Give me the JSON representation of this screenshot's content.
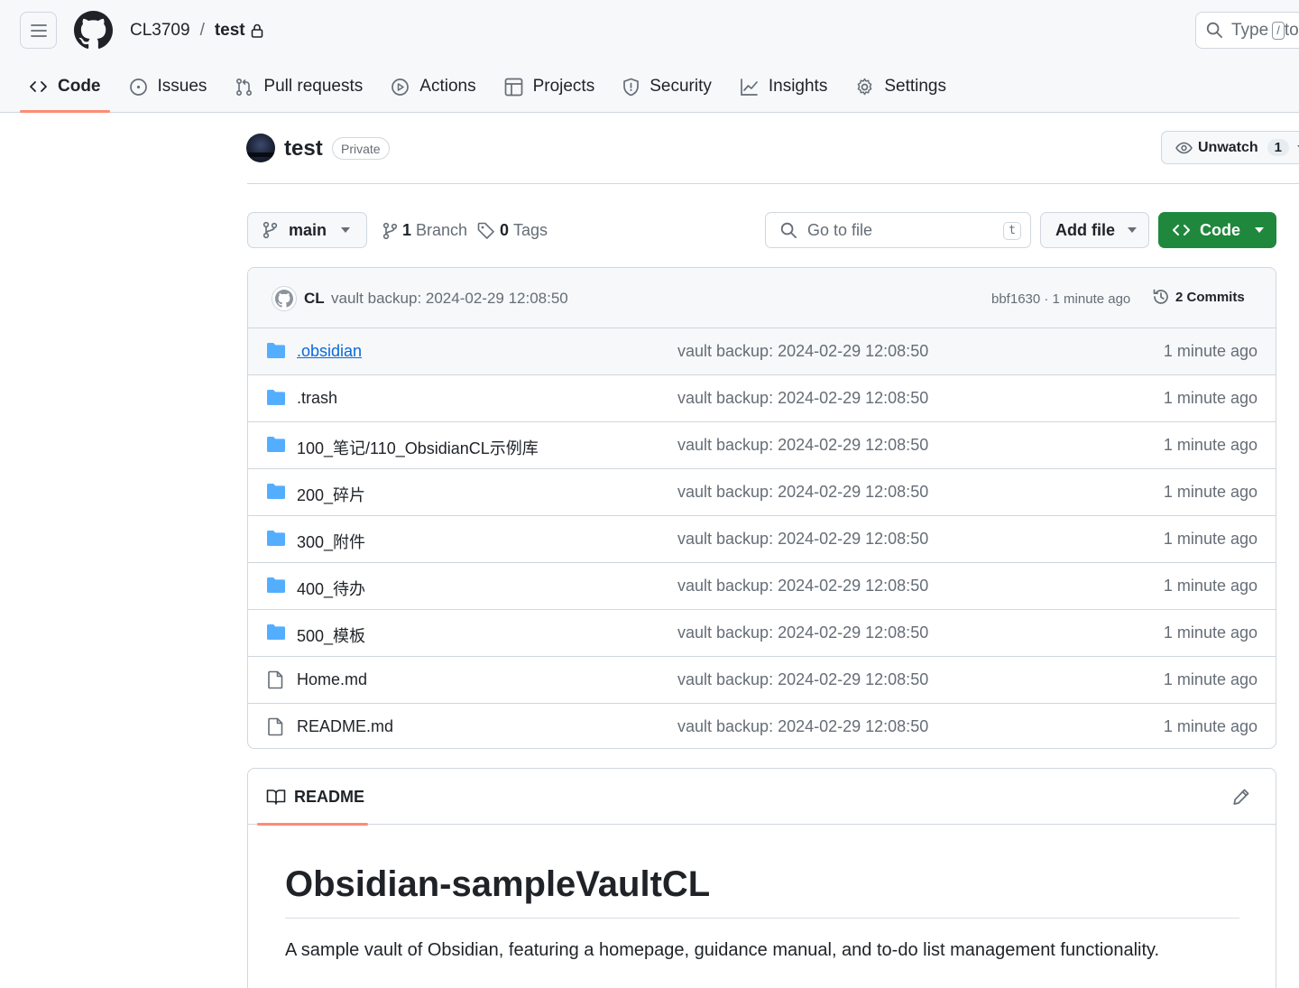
{
  "header": {
    "owner": "CL3709",
    "separator": "/",
    "repo": "test",
    "search_placeholder": "Type",
    "search_kbd": "/",
    "search_suffix": "to"
  },
  "tabs": [
    {
      "label": "Code",
      "icon": "code-icon",
      "selected": true
    },
    {
      "label": "Issues",
      "icon": "issue-icon"
    },
    {
      "label": "Pull requests",
      "icon": "pull-request-icon"
    },
    {
      "label": "Actions",
      "icon": "play-icon"
    },
    {
      "label": "Projects",
      "icon": "table-icon"
    },
    {
      "label": "Security",
      "icon": "shield-icon"
    },
    {
      "label": "Insights",
      "icon": "graph-icon"
    },
    {
      "label": "Settings",
      "icon": "gear-icon"
    }
  ],
  "repo_header": {
    "title": "test",
    "visibility": "Private",
    "watch_label": "Unwatch",
    "watch_count": "1"
  },
  "toolbar": {
    "branch": "main",
    "branch_count": "1",
    "branch_label": "Branch",
    "tag_count": "0",
    "tag_label": "Tags",
    "goto_placeholder": "Go to file",
    "goto_kbd": "t",
    "add_file": "Add file",
    "code": "Code"
  },
  "latest_commit": {
    "author": "CL",
    "message": "vault backup: 2024-02-29 12:08:50",
    "sha_age": "bbf1630 · 1 minute ago",
    "commits": "2 Commits"
  },
  "files": [
    {
      "type": "dir",
      "name": ".obsidian",
      "message": "vault backup: 2024-02-29 12:08:50",
      "age": "1 minute ago"
    },
    {
      "type": "dir",
      "name": ".trash",
      "message": "vault backup: 2024-02-29 12:08:50",
      "age": "1 minute ago"
    },
    {
      "type": "dir",
      "name": "100_笔记/110_ObsidianCL示例库",
      "message": "vault backup: 2024-02-29 12:08:50",
      "age": "1 minute ago"
    },
    {
      "type": "dir",
      "name": "200_碎片",
      "message": "vault backup: 2024-02-29 12:08:50",
      "age": "1 minute ago"
    },
    {
      "type": "dir",
      "name": "300_附件",
      "message": "vault backup: 2024-02-29 12:08:50",
      "age": "1 minute ago"
    },
    {
      "type": "dir",
      "name": "400_待办",
      "message": "vault backup: 2024-02-29 12:08:50",
      "age": "1 minute ago"
    },
    {
      "type": "dir",
      "name": "500_模板",
      "message": "vault backup: 2024-02-29 12:08:50",
      "age": "1 minute ago"
    },
    {
      "type": "file",
      "name": "Home.md",
      "message": "vault backup: 2024-02-29 12:08:50",
      "age": "1 minute ago"
    },
    {
      "type": "file",
      "name": "README.md",
      "message": "vault backup: 2024-02-29 12:08:50",
      "age": "1 minute ago"
    }
  ],
  "readme": {
    "tab_label": "README",
    "heading": "Obsidian-sampleVaultCL",
    "paragraph": "A sample vault of Obsidian, featuring a homepage, guidance manual, and to-do list management functionality."
  },
  "colors": {
    "accent_underline": "#fd8c73",
    "primary_button": "#1f883d",
    "folder_icon": "#54aeff",
    "link": "#0969da"
  }
}
